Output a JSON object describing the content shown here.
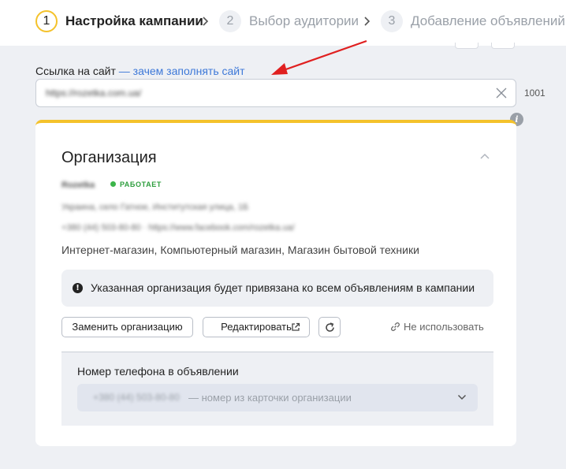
{
  "wizard": {
    "steps": [
      {
        "number": "1",
        "label": "Настройка кампании",
        "active": true
      },
      {
        "number": "2",
        "label": "Выбор аудитории",
        "active": false
      },
      {
        "number": "3",
        "label": "Добавление объявлений",
        "active": false
      }
    ]
  },
  "site_link": {
    "label": "Ссылка на сайт",
    "help_link": "— зачем заполнять сайт",
    "value": "https://rozetka.com.ua/",
    "counter": "1001"
  },
  "organization": {
    "title": "Организация",
    "name": "Rozetka",
    "status": "РАБОТАЕТ",
    "address": "Украина, село Гатное, Институтская улица, 1Б",
    "contacts": "+380 (44) 503-80-80 · https://www.facebook.com/rozetka.ua/",
    "categories": "Интернет-магазин, Компьютерный магазин, Магазин бытовой техники",
    "notice": "Указанная организация будет привязана ко всем объявлениям в кампании",
    "replace_button": "Заменить организацию",
    "edit_button": "Редактировать",
    "dont_use": "Не использовать",
    "phone": {
      "label": "Номер телефона в объявлении",
      "number": "+380 (44) 503-80-80",
      "hint": "— номер из карточки организации"
    }
  },
  "colors": {
    "accent": "#f4c22b",
    "link": "#3d78d8",
    "status_green": "#2e9e3e",
    "annotation_arrow": "#e02020"
  }
}
